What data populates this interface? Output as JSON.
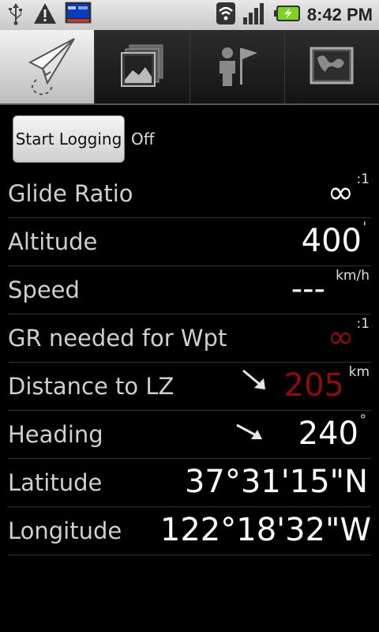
{
  "status_bar": {
    "time": "8:42 PM",
    "icons": [
      "usb-icon",
      "warning-icon",
      "notification-thumbnail-icon",
      "wifi-icon",
      "signal-icon",
      "battery-charging-icon"
    ]
  },
  "tabs": [
    {
      "name": "paper-plane-icon",
      "active": true
    },
    {
      "name": "gallery-icon",
      "active": false
    },
    {
      "name": "person-flag-icon",
      "active": false
    },
    {
      "name": "map-icon",
      "active": false
    }
  ],
  "logging": {
    "button_label": "Start Logging",
    "state": "Off"
  },
  "rows": {
    "glide_ratio": {
      "label": "Glide Ratio",
      "value": "∞",
      "unit": ":1"
    },
    "altitude": {
      "label": "Altitude",
      "value": "400",
      "unit": "'"
    },
    "speed": {
      "label": "Speed",
      "value": "---",
      "unit": "km/h"
    },
    "gr_needed": {
      "label": "GR needed for Wpt",
      "value": "∞",
      "unit": ":1"
    },
    "distance_lz": {
      "label": "Distance to LZ",
      "value": "205",
      "unit": "km"
    },
    "heading": {
      "label": "Heading",
      "value": "240",
      "unit": "°"
    },
    "latitude": {
      "label": "Latitude",
      "value": "37°31'15\"N"
    },
    "longitude": {
      "label": "Longitude",
      "value": "122°18'32\"W"
    }
  },
  "colors": {
    "warning_value": "#8b0d0d",
    "battery": "#7ed321"
  }
}
